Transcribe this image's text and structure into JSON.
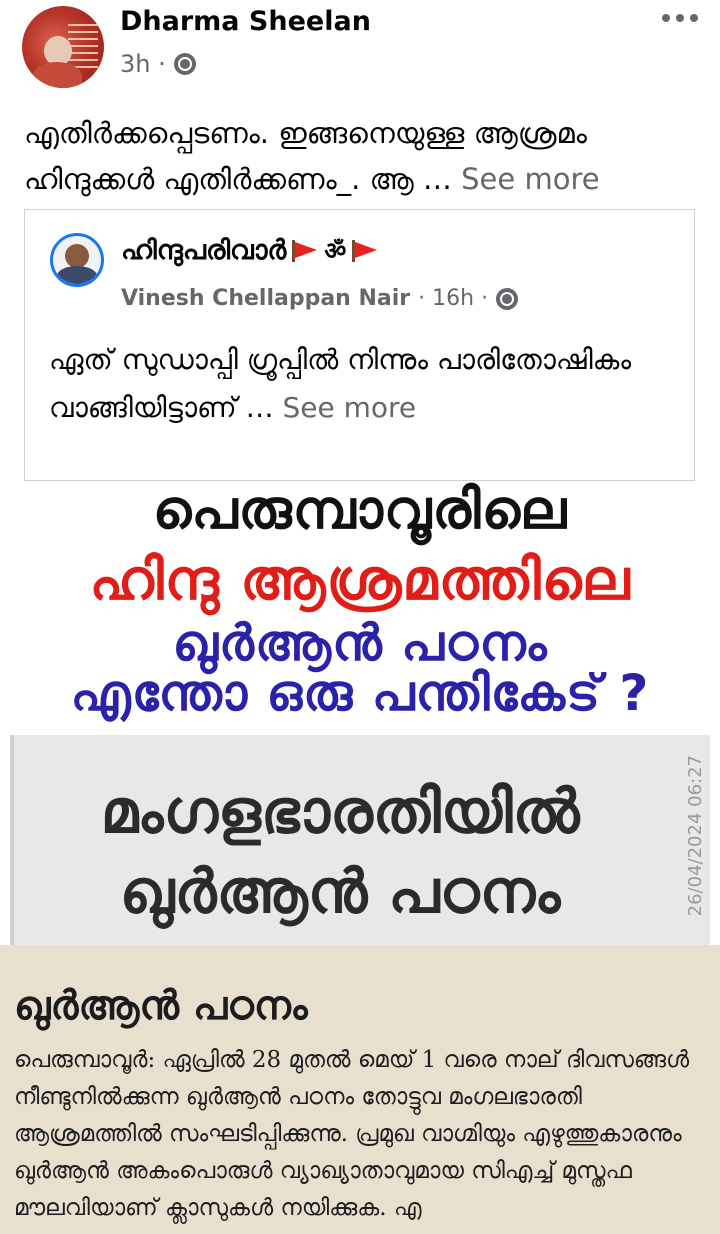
{
  "post": {
    "author": "Dharma Sheelan",
    "time": "3h ·",
    "text": "എതിർക്കപ്പെടണം. ഇങ്ങനെയുള്ള ആശ്രമം ഹിന്ദുക്കൾ എതിർക്കണം_. ആ …",
    "see_more": " See more"
  },
  "shared": {
    "group": "ഹിന്ദുപരിവാർ",
    "group_symbol": "ॐ",
    "poster": "Vinesh Chellappan Nair",
    "time": " · 16h ·",
    "text": "ഏത് സുഡാപ്പി ഗ്രൂപ്പിൽ നിന്നും പാരിതോഷികം വാങ്ങിയിട്ടാണ് …",
    "see_more": " See more"
  },
  "image": {
    "line1": "പെരുമ്പാവൂരിലെ",
    "line2": "ഹിന്ദു ആശ്രമത്തിലെ",
    "line3": "ഖുർആൻ പഠനം",
    "line4": "എന്തോ ഒരു പന്തികേട് ?",
    "clip1_line1": "മംഗളഭാരതിയിൽ",
    "clip1_line2": "ഖുർആൻ പഠനം",
    "clip1_stamp": "26/04/2024 06:27",
    "clip2_heading": "ഖുർആൻ പഠനം",
    "clip2_body": "പെരുമ്പാവൂർ: ഏപ്രിൽ 28 മുതൽ മെയ് 1 വരെ നാല് ദിവസങ്ങൾ നീണ്ടുനിൽക്കുന്ന ഖുർആൻ പഠനം തോട്ടുവ മംഗലഭാരതി ആശ്രമത്തിൽ സംഘടിപ്പിക്കുന്നു. പ്രമുഖ വാഗ്മിയും എഴുത്തുകാരനും ഖുർആൻ അകംപൊരുൾ വ്യാഖ്യാതാവുമായ സിഎച്ച് മുസ്തഫ മൗലവിയാണ് ക്ലാസുകൾ നയിക്കുക. എ"
  },
  "colors": {
    "meta_gray": "#65676b",
    "headline_red": "#e01e17",
    "headline_blue": "#2a22a8",
    "link_blue": "#1877f2"
  },
  "icons": [
    "globe-icon",
    "more-options-icon",
    "flag-icon"
  ]
}
